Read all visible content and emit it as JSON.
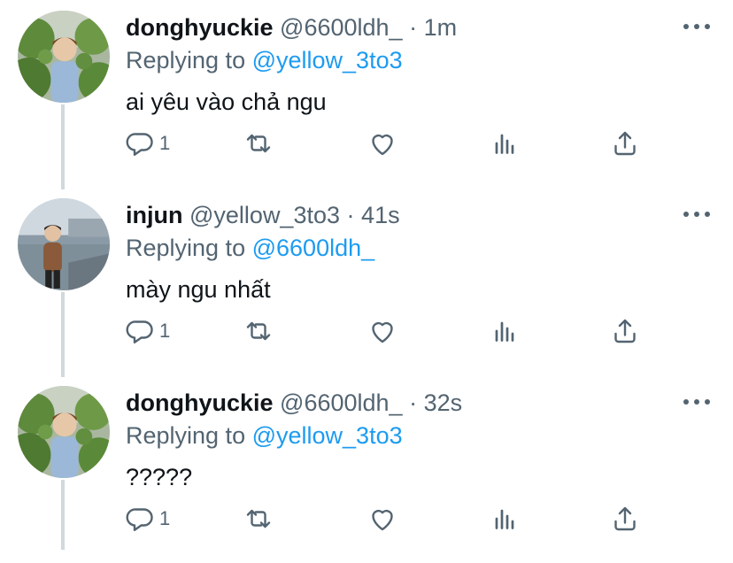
{
  "tweets": [
    {
      "name": "donghyuckie",
      "handle": "@6600ldh_",
      "separator": "·",
      "time": "1m",
      "replying_prefix": "Replying to",
      "replying_to": "@yellow_3to3",
      "text": "ai yêu vào chả ngu",
      "reply_count": "1",
      "avatar": "avatar-garden-photo"
    },
    {
      "name": "injun",
      "handle": "@yellow_3to3",
      "separator": "·",
      "time": "41s",
      "replying_prefix": "Replying to",
      "replying_to": "@6600ldh_",
      "text": "mày ngu nhất",
      "reply_count": "1",
      "avatar": "avatar-riverside-photo"
    },
    {
      "name": "donghyuckie",
      "handle": "@6600ldh_",
      "separator": "·",
      "time": "32s",
      "replying_prefix": "Replying to",
      "replying_to": "@yellow_3to3",
      "text": "?????",
      "reply_count": "1",
      "avatar": "avatar-garden-photo"
    }
  ],
  "icons": {
    "reply": "reply-icon",
    "retweet": "retweet-icon",
    "like": "like-icon",
    "views": "views-icon",
    "share": "share-icon",
    "more": "more-icon"
  },
  "colors": {
    "text": "#0f1419",
    "secondary": "#536471",
    "link": "#1d9bf0",
    "thread_line": "#cfd9de"
  }
}
